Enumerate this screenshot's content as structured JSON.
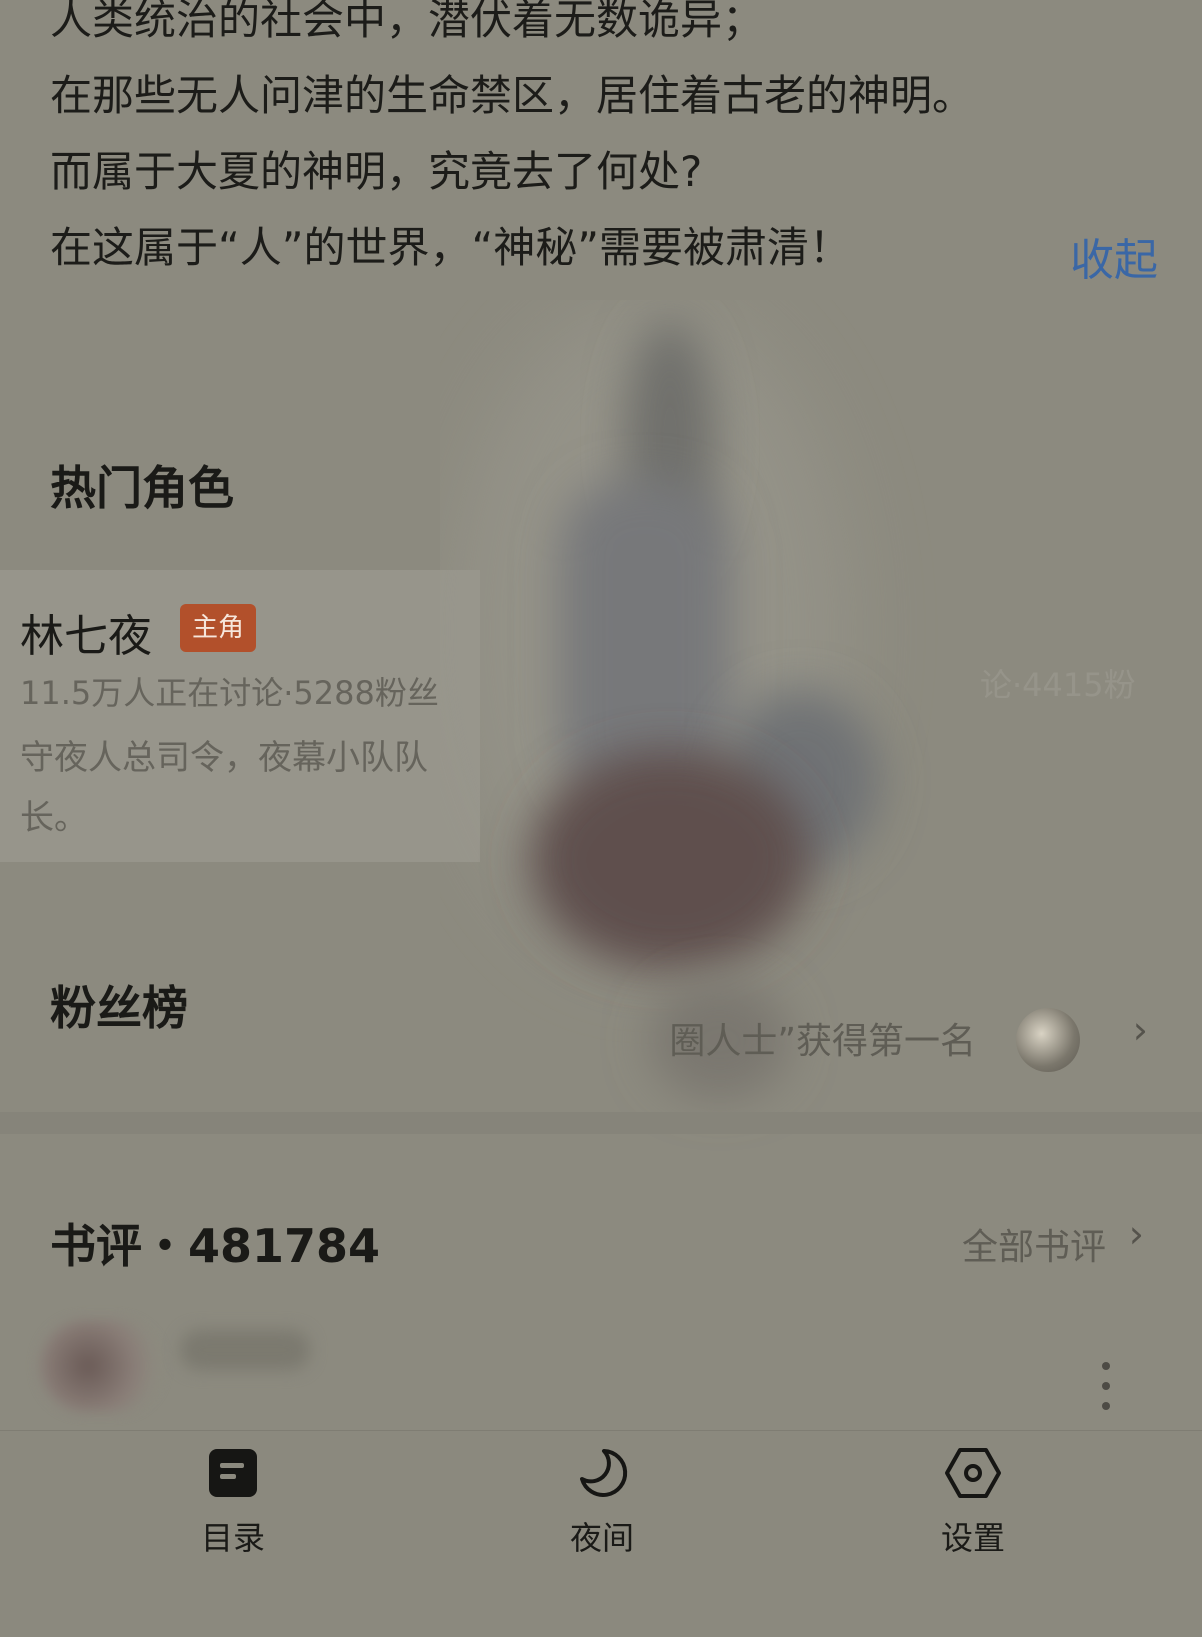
{
  "intro": {
    "lines": [
      "人类统治的社会中，潜伏着无数诡异；",
      "在那些无人问津的生命禁区，居住着古老的神明。",
      "而属于大夏的神明，究竟去了何处?",
      "在这属于“人”的世界，“神秘”需要被肃清！"
    ],
    "collapse_label": "收起"
  },
  "hot_characters": {
    "title": "热门角色",
    "card": {
      "name": "林七夜",
      "tag": "主角",
      "stats": "11.5万人正在讨论·5288粉丝",
      "description": "守夜人总司令，夜幕小队队长。"
    },
    "faint_card_stats": "论·4415粉"
  },
  "fan_ranking": {
    "title": "粉丝榜",
    "note": "圈人士”获得第一名"
  },
  "reviews": {
    "title": "书评・481784",
    "all_label": "全部书评"
  },
  "toolbar": {
    "items": [
      {
        "label": "目录",
        "icon": "catalog-icon"
      },
      {
        "label": "夜间",
        "icon": "moon-icon"
      },
      {
        "label": "设置",
        "icon": "settings-hexagon-icon"
      }
    ]
  },
  "colors": {
    "background": "#8c8a7f",
    "link": "#3a67a6",
    "tag": "#b2502b"
  }
}
